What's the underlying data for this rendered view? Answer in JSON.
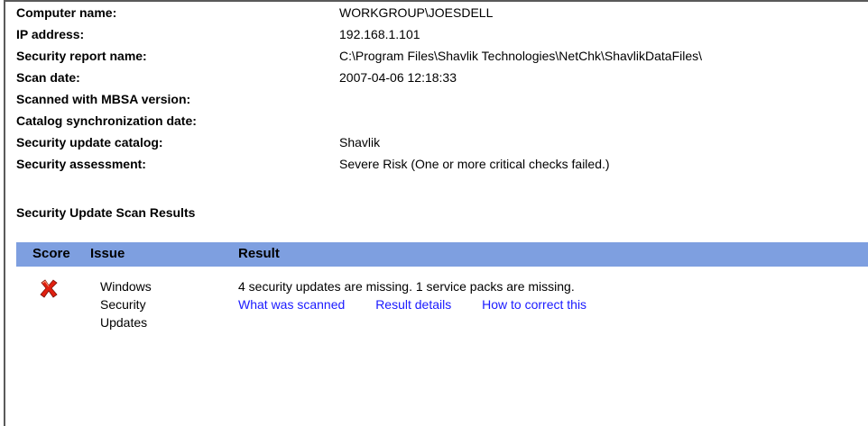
{
  "info": {
    "rows": [
      {
        "label": "Computer name:",
        "value": "WORKGROUP\\JOESDELL"
      },
      {
        "label": "IP address:",
        "value": "192.168.1.101"
      },
      {
        "label": "Security report name:",
        "value": "C:\\Program Files\\Shavlik Technologies\\NetChk\\ShavlikDataFiles\\"
      },
      {
        "label": "Scan date:",
        "value": "2007-04-06 12:18:33"
      },
      {
        "label": "Scanned with MBSA version:",
        "value": ""
      },
      {
        "label": "Catalog synchronization date:",
        "value": ""
      },
      {
        "label": "Security update catalog:",
        "value": "Shavlik"
      },
      {
        "label": "Security assessment:",
        "value": "Severe Risk (One or more critical checks failed.)"
      }
    ]
  },
  "section_title": "Security Update Scan Results",
  "table": {
    "headers": {
      "score": "Score",
      "issue": "Issue",
      "result": "Result"
    },
    "rows": [
      {
        "score_icon": "red-x-icon",
        "issue_lines": [
          "Windows",
          "Security",
          "Updates"
        ],
        "result": "4 security updates are missing. 1 service packs are missing.",
        "links": [
          "What was scanned",
          "Result details",
          "How to correct this"
        ]
      }
    ]
  },
  "colors": {
    "header_bg": "#7e9fe0",
    "link": "#1a1aff",
    "fail_icon": "#e02010"
  }
}
